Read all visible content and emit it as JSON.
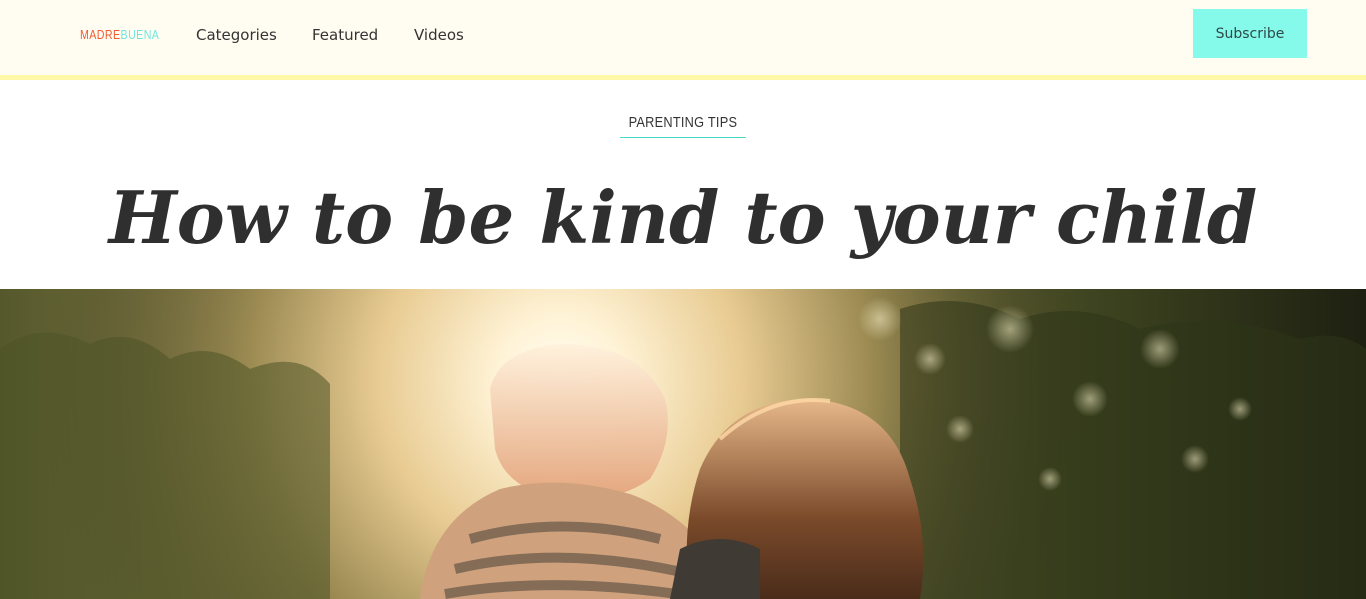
{
  "header": {
    "logo": {
      "part1": "MADRE",
      "part2": "BUENA"
    },
    "nav": [
      {
        "label": "Categories"
      },
      {
        "label": "Featured"
      },
      {
        "label": "Videos"
      }
    ],
    "subscribe_label": "Subscribe"
  },
  "article": {
    "category": "PARENTING TIPS",
    "title": "How to be kind to your child"
  },
  "hero": {
    "alt": "Two children hugging in the sunlight"
  },
  "colors": {
    "header_bg": "#fffdf2",
    "header_rule": "#fdf9a6",
    "logo_primary": "#f15a32",
    "logo_secondary": "#6ee6de",
    "subscribe_bg": "#85f9ea",
    "category_underline": "#48d6c6",
    "title": "#2f2f2f"
  }
}
